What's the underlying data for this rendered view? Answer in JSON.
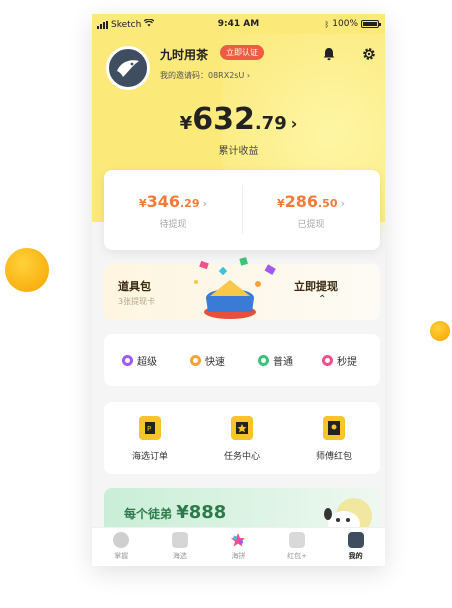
{
  "status_bar": {
    "carrier": "Sketch",
    "time": "9:41 AM",
    "battery": "100%"
  },
  "profile": {
    "username": "九时用茶",
    "verify_badge": "立即认证",
    "invite_code": "我的邀请码：08RX2sU"
  },
  "earnings": {
    "currency": "¥",
    "total_int": "632",
    "total_dec": ".79",
    "total_label": "累计收益",
    "pending_int": "346",
    "pending_dec": ".29",
    "pending_label": "待提现",
    "withdrawn_int": "286",
    "withdrawn_dec": ".50",
    "withdrawn_label": "已提现"
  },
  "banner": {
    "title": "道具包",
    "subtitle": "3张提现卡",
    "action": "立即提现"
  },
  "speed_options": [
    {
      "label": "超级",
      "color": "#a05af0"
    },
    {
      "label": "快速",
      "color": "#f5a23a"
    },
    {
      "label": "普通",
      "color": "#3cc27a"
    },
    {
      "label": "秒提",
      "color": "#f0508c"
    }
  ],
  "menu": [
    {
      "label": "海选订单",
      "icon": "order-icon"
    },
    {
      "label": "任务中心",
      "icon": "task-icon"
    },
    {
      "label": "师傅红包",
      "icon": "red-packet-icon"
    }
  ],
  "promo": {
    "text": "每个徒弟",
    "amount": "¥888"
  },
  "tabs": [
    {
      "label": "掌握",
      "icon": "home-icon"
    },
    {
      "label": "海选",
      "icon": "select-icon"
    },
    {
      "label": "海拼",
      "icon": "star-icon"
    },
    {
      "label": "红包+",
      "icon": "redpack-icon"
    },
    {
      "label": "我的",
      "icon": "profile-icon"
    }
  ],
  "colors": {
    "hero_bg": "#fbe97a",
    "accent_orange": "#f47a3a",
    "badge_red": "#f25a43"
  }
}
